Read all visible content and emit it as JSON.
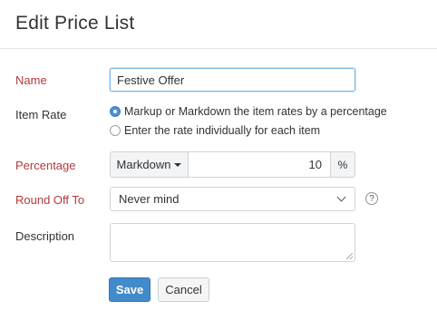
{
  "header": {
    "title": "Edit Price List"
  },
  "form": {
    "name": {
      "label": "Name",
      "value": "Festive Offer"
    },
    "item_rate": {
      "label": "Item Rate",
      "options": [
        {
          "label": "Markup or Markdown the item rates by a percentage",
          "selected": true
        },
        {
          "label": "Enter the rate individually for each item",
          "selected": false
        }
      ]
    },
    "percentage": {
      "label": "Percentage",
      "mode": "Markdown",
      "value": "10",
      "unit": "%"
    },
    "round_off": {
      "label": "Round Off To",
      "value": "Never mind",
      "help": "?"
    },
    "description": {
      "label": "Description",
      "value": ""
    }
  },
  "actions": {
    "save_label": "Save",
    "cancel_label": "Cancel"
  },
  "colors": {
    "required_label": "#b33a3a",
    "primary": "#418bca",
    "focus_border": "#7fb4e6"
  }
}
